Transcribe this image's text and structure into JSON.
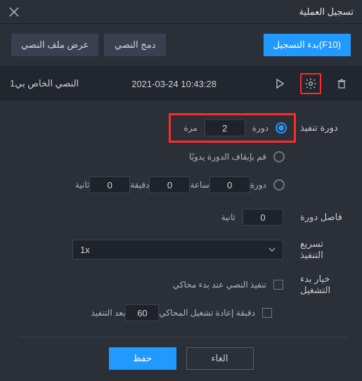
{
  "window": {
    "title": "تسجيل العملية"
  },
  "toolbar": {
    "start_record": "(F10)بدء التسجيل",
    "merge_script": "دمج النصي",
    "show_script": "عرض ملف النصي"
  },
  "scriptbar": {
    "name": "النصي الخاص بي1",
    "date": "2021-03-24 10:43:28"
  },
  "labels": {
    "loop_exec": "دورة تنفيذ",
    "loop_interval": "فاصل دورة",
    "speed_exec": "تسريع التنفيذ",
    "start_option": "خيار بدء التشغيل"
  },
  "options": {
    "loop_times": {
      "value": "2",
      "unit_before": "دورة",
      "unit_after": "مرة"
    },
    "manual_pause": "قم بإيقاف الدورة يدويًا",
    "time_loop": {
      "loop_label": "دورة",
      "loop": "0",
      "hours_label": "ساعة",
      "hours": "0",
      "minutes_label": "دقيقة",
      "minutes": "0",
      "seconds_label": "ثانية"
    },
    "interval": {
      "value": "0",
      "seconds_label": "ثانية"
    },
    "speed": {
      "value": "1x"
    },
    "run_on_start": "تنفيذ النصي عند بدء محاكي",
    "restart_after": {
      "label_prefix": "دقبقة إعادة تشغيل المحاكي",
      "minutes": "60",
      "label_suffix": "بعد التنفيذ"
    }
  },
  "footer": {
    "cancel": "الغاء",
    "save": "حفظ"
  }
}
